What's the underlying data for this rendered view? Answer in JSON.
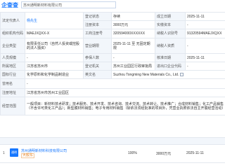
{
  "header": {
    "logo": "企查查",
    "search_value": "苏州通明新材料有限公司"
  },
  "info": {
    "legal_rep_label": "法定代表人",
    "legal_rep": "杨先生",
    "status_label": "登记状态",
    "status": "存续",
    "founded_label": "成立日期",
    "founded": "2025-11-11",
    "reg_capital_label": "注册资本",
    "reg_capital": "3000万元",
    "paid_capital_label": "实缴资本",
    "paid_capital": "-",
    "org_code_label": "组织机构代码",
    "org_code": "MAEJXQXX-X",
    "reg_no_label": "工商注册号",
    "reg_no": "320594000XXXXXX",
    "tax_id_label": "纳税人识别号",
    "tax_id": "91320594MAEJXQXX",
    "type_label": "企业类型",
    "type": "有限责任公司（自然人投资或控股的法人独资）",
    "term_label": "营业期限",
    "term": "2025-11-11 至 无固定期限",
    "tax_qual_label": "纳税人资质",
    "tax_qual": "-",
    "staff_label": "人员规模",
    "staff": "-",
    "insured_label": "参保人数",
    "insured": "-",
    "approved_label": "核准日期",
    "approved": "2025-11-11",
    "region_label": "所属地区",
    "region": "江苏省苏州市",
    "authority_label": "登记机关",
    "authority": "苏州工业园区行政审批局",
    "ie_code_label": "进出口企业代码",
    "ie_code": "-",
    "industry_label": "国标行业",
    "industry": "化学原料和化学制品制造业",
    "en_name_label": "英文名",
    "en_name": "Suzhou Tongming New Materials Co., Ltd.",
    "former_name_label": "曾用名",
    "former_name": "-",
    "address_label": "注册地址",
    "address": "江苏省苏州市苏州工业园区",
    "scope_label": "经营范围",
    "scope": "一般项目：新材料技术研发；技术服务、技术开发、技术咨询、技术交流、技术转让、技术推广；合成材料销售；化工产品销售（不含许可类化工产品）；新型膜材料销售；电子专用材料销售（除依法须经批准的项目外，凭营业执照依法自主开展经营活动）"
  },
  "shareholder": {
    "number": "1",
    "logo_text": "通明",
    "name": "苏州通明新材料科技有限公司",
    "tag": "大股东",
    "ratio": "100%",
    "amount": "3000万元",
    "date": "2025-11-11"
  },
  "colors": {
    "accent": "#1677ff",
    "label_bg": "#f2f6fb",
    "border": "#e3e8ef"
  }
}
